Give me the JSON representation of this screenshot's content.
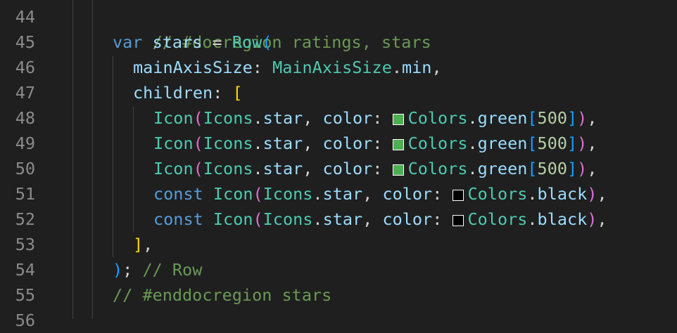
{
  "editor": {
    "line_numbers": [
      "44",
      "45",
      "46",
      "47",
      "48",
      "49",
      "50",
      "51",
      "52",
      "53",
      "54",
      "55",
      "56"
    ],
    "lines": {
      "l44": {
        "comment": "// #docregion ratings, stars"
      },
      "l45": {
        "kw": "var",
        "name": "stars",
        "eq": " = ",
        "call": "Row",
        "open": "("
      },
      "l46": {
        "prop": "mainAxisSize",
        "colon": ": ",
        "type": "MainAxisSize",
        "dot": ".",
        "member": "min",
        "comma": ","
      },
      "l47": {
        "prop": "children",
        "colon": ": ",
        "open": "["
      },
      "l48": {
        "call": "Icon",
        "open": "(",
        "type": "Icons",
        "dot": ".",
        "member": "star",
        "sep": ", ",
        "prop": "color",
        "colon": ": ",
        "type2": "Colors",
        "dot2": ".",
        "member2": "green",
        "lb": "[",
        "num": "500",
        "rb": "]",
        "close": ")",
        "comma": ","
      },
      "l49": {
        "call": "Icon",
        "open": "(",
        "type": "Icons",
        "dot": ".",
        "member": "star",
        "sep": ", ",
        "prop": "color",
        "colon": ": ",
        "type2": "Colors",
        "dot2": ".",
        "member2": "green",
        "lb": "[",
        "num": "500",
        "rb": "]",
        "close": ")",
        "comma": ","
      },
      "l50": {
        "call": "Icon",
        "open": "(",
        "type": "Icons",
        "dot": ".",
        "member": "star",
        "sep": ", ",
        "prop": "color",
        "colon": ": ",
        "type2": "Colors",
        "dot2": ".",
        "member2": "green",
        "lb": "[",
        "num": "500",
        "rb": "]",
        "close": ")",
        "comma": ","
      },
      "l51": {
        "kw": "const",
        "call": "Icon",
        "open": "(",
        "type": "Icons",
        "dot": ".",
        "member": "star",
        "sep": ", ",
        "prop": "color",
        "colon": ": ",
        "type2": "Colors",
        "dot2": ".",
        "member2": "black",
        "close": ")",
        "comma": ","
      },
      "l52": {
        "kw": "const",
        "call": "Icon",
        "open": "(",
        "type": "Icons",
        "dot": ".",
        "member": "star",
        "sep": ", ",
        "prop": "color",
        "colon": ": ",
        "type2": "Colors",
        "dot2": ".",
        "member2": "black",
        "close": ")",
        "comma": ","
      },
      "l53": {
        "close": "]",
        "comma": ","
      },
      "l54": {
        "close": ")",
        "semi": ";",
        "comment": "// Row"
      },
      "l55": {
        "comment": "// #enddocregion stars"
      }
    },
    "colors": {
      "background": "#1f1f1f",
      "green_500": "#4caf50",
      "black": "#000000"
    }
  }
}
